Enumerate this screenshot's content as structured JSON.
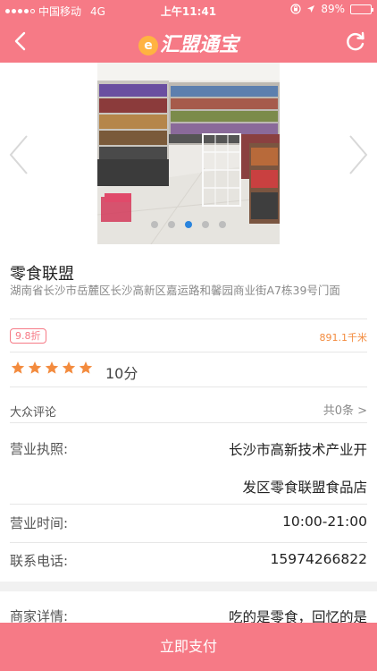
{
  "status_bar": {
    "carrier": "中国移动",
    "network": "4G",
    "time": "上午11:41",
    "battery": "89%",
    "battery_level": 0.89,
    "signal_bars_filled": 4
  },
  "nav": {
    "logo_mark": "e",
    "logo_text": "汇盟通宝",
    "back_icon": "chevron-left-icon",
    "refresh_icon": "refresh-icon"
  },
  "carousel": {
    "slide_count": 5,
    "active_index": 2
  },
  "shop": {
    "name": "零食联盟",
    "address": "湖南省长沙市岳麓区长沙高新区嘉运路和馨园商业街A7栋39号门面",
    "discount": "9.8折",
    "distance": "891.1千米",
    "rating_stars": 5,
    "score": "10分"
  },
  "reviews": {
    "label": "大众评论",
    "count": "共0条 >"
  },
  "details": {
    "license_label": "营业执照:",
    "license_value_line1": "长沙市高新技术产业开",
    "license_value_line2": "发区零食联盟食品店",
    "hours_label": "营业时间:",
    "hours_value": "10:00-21:00",
    "phone_label": "联系电话:",
    "phone_value": "15974266822",
    "detail_label": "商家详情:",
    "detail_value": "吃的是零食，回忆的是"
  },
  "pay_button": "立即支付",
  "colors": {
    "brand": "#f67a86",
    "accent_orange": "#f38b3e",
    "star": "#f38b3e",
    "dot_active": "#2a84dd"
  }
}
